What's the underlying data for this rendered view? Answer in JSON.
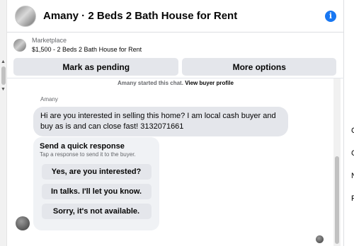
{
  "header": {
    "title": "Amany · 2 Beds 2 Bath House for Rent",
    "info_icon": "info-icon"
  },
  "listing": {
    "category": "Marketplace",
    "name": "$1,500 - 2 Beds 2 Bath House for Rent"
  },
  "actions": {
    "pending_label": "Mark as pending",
    "more_label": "More options"
  },
  "thread": {
    "started_text": "Amany started this chat.",
    "profile_link": "View buyer profile",
    "sender_name": "Amany",
    "message": "Hi are you interested in selling this home?  I am local cash buyer and buy as is and can close fast!  3132071661"
  },
  "quick_response": {
    "title": "Send a quick response",
    "subtitle": "Tap a response to send it to the buyer.",
    "options": [
      "Yes, are you interested?",
      "In talks. I'll let you know.",
      "Sorry, it's not available."
    ]
  },
  "right_column": [
    "C",
    "C",
    "N",
    "F"
  ]
}
